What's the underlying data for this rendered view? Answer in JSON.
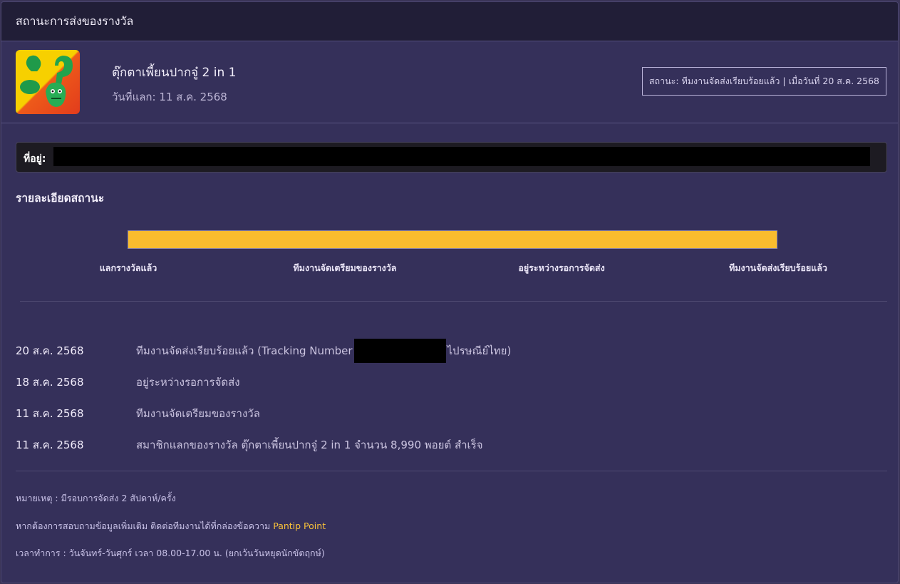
{
  "header": {
    "title": "สถานะการส่งของรางวัล"
  },
  "prize": {
    "name": "ตุ๊กตาเพี้ยนปากจู๋ 2 in 1",
    "redeem_date": "วันที่แลก: 11 ส.ค. 2568",
    "status": "สถานะ: ทีมงานจัดส่งเรียบร้อยแล้ว | เมื่อวันที่ 20 ส.ค. 2568"
  },
  "address": {
    "label": "ที่อยู่:"
  },
  "status_section": {
    "title": "รายละเอียดสถานะ",
    "progress_fraction": 1.0,
    "steps": [
      "แลกรางวัลแล้ว",
      "ทีมงานจัดเตรียมของรางวัล",
      "อยู่ระหว่างรอการจัดส่ง",
      "ทีมงานจัดส่งเรียบร้อยแล้ว"
    ]
  },
  "timeline": [
    {
      "date": "20 ส.ค. 2568",
      "text_before": "ทีมงานจัดส่งเรียบร้อยแล้ว (Tracking Number",
      "text_after": "ไปรษณีย์ไทย)"
    },
    {
      "date": "18 ส.ค. 2568",
      "text": "อยู่ระหว่างรอการจัดส่ง"
    },
    {
      "date": "11 ส.ค. 2568",
      "text": "ทีมงานจัดเตรียมของรางวัล"
    },
    {
      "date": "11 ส.ค. 2568",
      "text": "สมาชิกแลกของรางวัล ตุ๊กตาเพี้ยนปากจู๋ 2 in 1 จำนวน 8,990 พอยต์ สำเร็จ"
    }
  ],
  "notes": {
    "note1": "หมายเหตุ : มีรอบการจัดส่ง 2 สัปดาห์/ครั้ง",
    "note2_prefix": "หากต้องการสอบถามข้อมูลเพิ่มเติม ติดต่อทีมงานได้ที่กล่องข้อความ ",
    "note2_link": "Pantip Point",
    "note3": "เวลาทำการ : วันจันทร์-วันศุกร์ เวลา 08.00-17.00 น. (ยกเว้นวันหยุดนักขัตฤกษ์)"
  },
  "colors": {
    "accent": "#f9bc2e",
    "link": "#f9c23a",
    "background": "#35305a",
    "header": "#211e37"
  }
}
